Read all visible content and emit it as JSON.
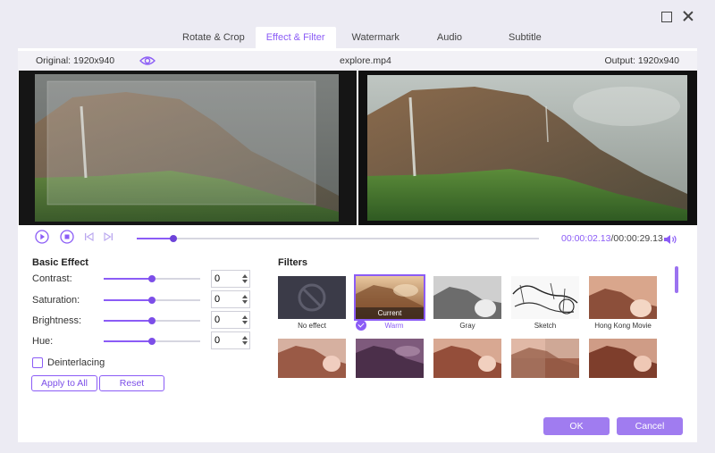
{
  "tabs": [
    {
      "label": "Rotate & Crop"
    },
    {
      "label": "Effect & Filter"
    },
    {
      "label": "Watermark"
    },
    {
      "label": "Audio"
    },
    {
      "label": "Subtitle"
    }
  ],
  "preview": {
    "original_label": "Original: 1920x940",
    "filename": "explore.mp4",
    "output_label": "Output: 1920x940"
  },
  "playback": {
    "current_time": "00:00:02.13",
    "separator": "/",
    "total_time": "00:00:29.13",
    "progress_fraction": 0.09
  },
  "basic_effect": {
    "title": "Basic Effect",
    "adjustments": [
      {
        "label": "Contrast:",
        "value": "0",
        "level": 0.5
      },
      {
        "label": "Saturation:",
        "value": "0",
        "level": 0.5
      },
      {
        "label": "Brightness:",
        "value": "0",
        "level": 0.5
      },
      {
        "label": "Hue:",
        "value": "0",
        "level": 0.5
      }
    ],
    "deinterlacing_label": "Deinterlacing",
    "apply_all_label": "Apply to All",
    "reset_label": "Reset"
  },
  "filters": {
    "title": "Filters",
    "current_badge": "Current",
    "items": [
      {
        "label": "No effect"
      },
      {
        "label": "Warm"
      },
      {
        "label": "Gray"
      },
      {
        "label": "Sketch"
      },
      {
        "label": "Hong Kong Movie"
      }
    ]
  },
  "footer": {
    "ok_label": "OK",
    "cancel_label": "Cancel"
  },
  "colors": {
    "accent": "#8b5cf6",
    "window_bg": "#ecebf3",
    "panel_bg": "#ffffff"
  }
}
